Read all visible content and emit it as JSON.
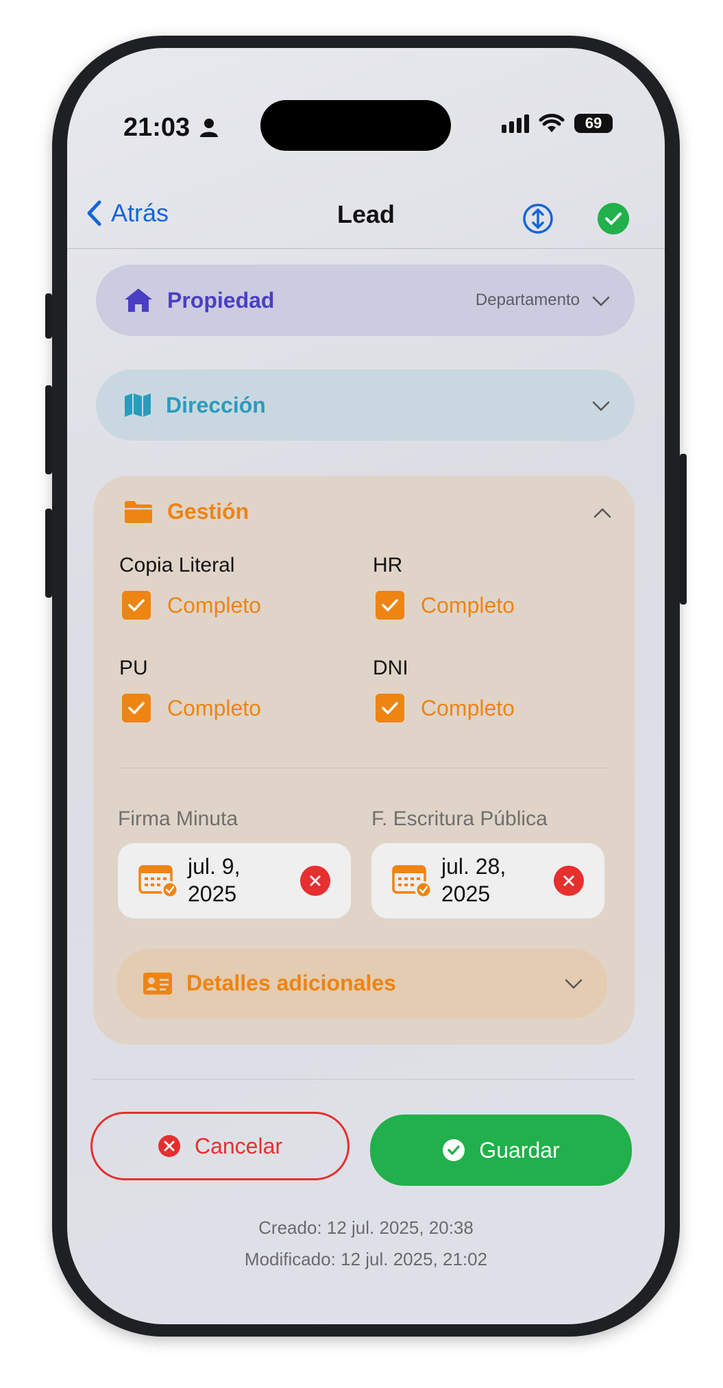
{
  "status_bar": {
    "time": "21:03",
    "battery": "69"
  },
  "nav": {
    "back_label": "Atrás",
    "title": "Lead"
  },
  "propiedad": {
    "title": "Propiedad",
    "value": "Departamento"
  },
  "direccion": {
    "title": "Dirección"
  },
  "gestion": {
    "title": "Gestión",
    "items": [
      {
        "label": "Copia Literal",
        "status": "Completo"
      },
      {
        "label": "HR",
        "status": "Completo"
      },
      {
        "label": "PU",
        "status": "Completo"
      },
      {
        "label": "DNI",
        "status": "Completo"
      }
    ],
    "dates": [
      {
        "label": "Firma Minuta",
        "line1": "jul. 9,",
        "line2": "2025"
      },
      {
        "label": "F. Escritura Pública",
        "line1": "jul. 28,",
        "line2": "2025"
      }
    ],
    "details_title": "Detalles adicionales"
  },
  "actions": {
    "cancel_label": "Cancelar",
    "save_label": "Guardar"
  },
  "meta": {
    "created": "Creado: 12 jul. 2025, 20:38",
    "modified": "Modificado: 12 jul. 2025, 21:02"
  },
  "colors": {
    "accent_blue": "#1565d8",
    "propiedad": "#4a3fc4",
    "direccion": "#2a9bbd",
    "gestion": "#ee8412",
    "cancel": "#e62f2f",
    "save": "#21b04b"
  }
}
